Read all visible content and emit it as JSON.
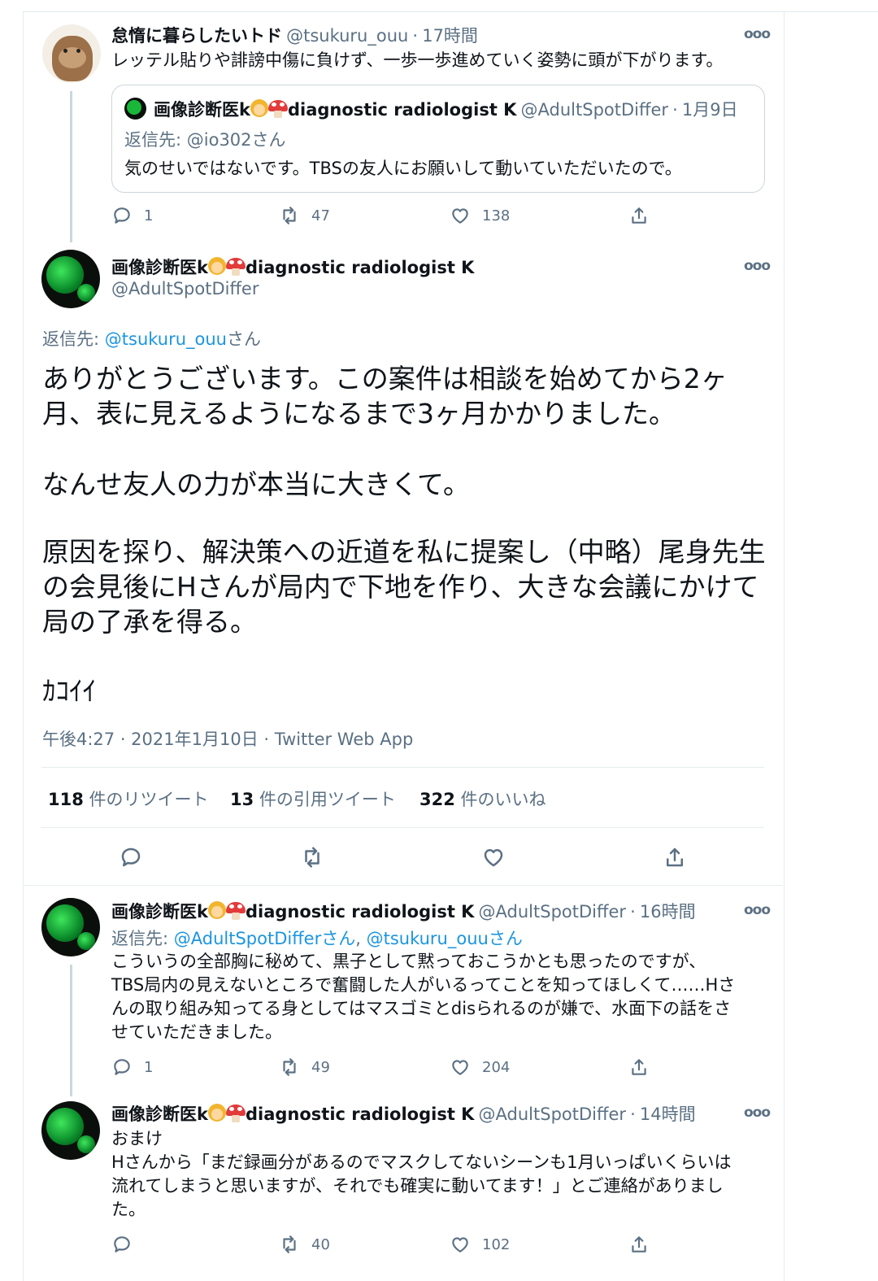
{
  "tweet1": {
    "name": "怠惰に暮らしたいトド",
    "handle": "@tsukuru_ouu",
    "sep": "·",
    "time": "17時間",
    "text": "レッテル貼りや誹謗中傷に負けず、一歩一歩進めていく姿勢に頭が下がります。",
    "quote": {
      "name_a": "画像診断医k",
      "name_b": "diagnostic radiologist K",
      "handle": "@AdultSpotDiffer",
      "sep": "·",
      "date": "1月9日",
      "reply_prefix": "返信先: ",
      "reply_to": "@io302さん",
      "text": "気のせいではないです。TBSの友人にお願いして動いていただいたので。"
    },
    "actions": {
      "reply": "1",
      "retweet": "47",
      "like": "138"
    }
  },
  "main": {
    "name_a": "画像診断医k",
    "name_b": "diagnostic radiologist K",
    "handle": "@AdultSpotDiffer",
    "reply_prefix": "返信先: ",
    "reply_to": "@tsukuru_ouu",
    "reply_suffix": "さん",
    "line1": "ありがとうございます。この案件は相談を始めてから2ヶ",
    "line2": "月、表に見えるようになるまで3ヶ月かかりました。",
    "line3": "なんせ友人の力が本当に大きくて。",
    "line4": "原因を探り、解決策への近道を私に提案し（中略）尾身先生",
    "line5": "の会見後にHさんが局内で下地を作り、大きな会議にかけて",
    "line6": "局の了承を得る。",
    "line7": "ｶｺｲｲ",
    "meta": "午後4:27 · 2021年1月10日 · Twitter Web App",
    "stats": {
      "retweets_num": "118",
      "retweets_label": " 件のリツイート",
      "quotes_num": "13",
      "quotes_label": " 件の引用ツイート",
      "likes_num": "322",
      "likes_label": " 件のいいね"
    }
  },
  "reply1": {
    "name_a": "画像診断医k",
    "name_b": "diagnostic radiologist K",
    "handle": "@AdultSpotDiffer",
    "sep": "·",
    "time": "16時間",
    "reply_prefix": "返信先: ",
    "reply_to_1": "@AdultSpotDifferさん",
    "reply_comma": ", ",
    "reply_to_2": "@tsukuru_ouuさん",
    "line1": "こういうの全部胸に秘めて、黒子として黙っておこうかとも思ったのですが、",
    "line2": "TBS局内の見えないところで奮闘した人がいるってことを知ってほしくて……Hさ",
    "line3": "んの取り組み知ってる身としてはマスゴミとdisられるのが嫌で、水面下の話をさ",
    "line4": "せていただきました。",
    "actions": {
      "reply": "1",
      "retweet": "49",
      "like": "204"
    }
  },
  "reply2": {
    "name_a": "画像診断医k",
    "name_b": "diagnostic radiologist K",
    "handle": "@AdultSpotDiffer",
    "sep": "·",
    "time": "14時間",
    "line1": "おまけ",
    "line2": "Hさんから「まだ録画分があるのでマスクしてないシーンも1月いっぱいくらいは",
    "line3": "流れてしまうと思いますが、それでも確実に動いてます！」とご連絡がありまし",
    "line4": "た。",
    "actions": {
      "reply": "",
      "retweet": "40",
      "like": "102"
    }
  },
  "more_glyph": "ooo"
}
